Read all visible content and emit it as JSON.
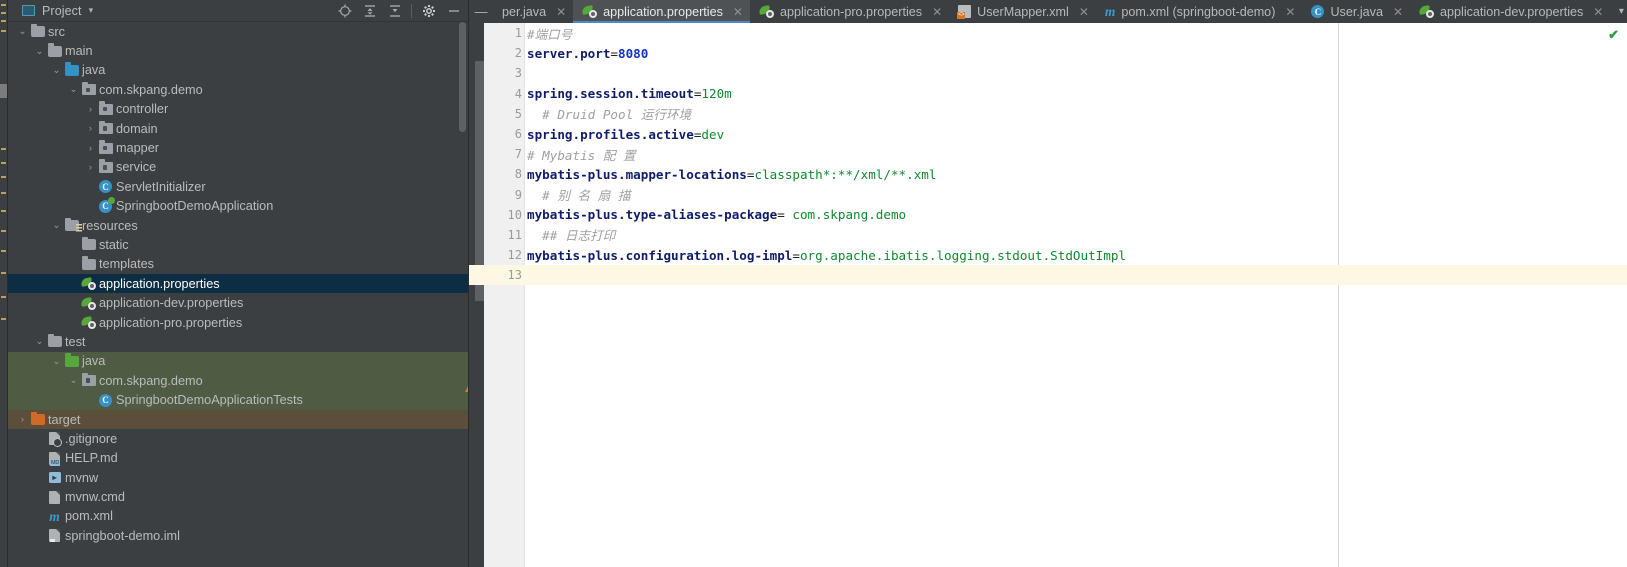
{
  "window": {
    "accent_blue": "#4a88c7",
    "sidebar_bg": "#3c3f41",
    "selection_bg": "#0d2d42"
  },
  "project_panel": {
    "title": "Project",
    "title_chevron": "▾",
    "window_icon": "project-window-icon",
    "tools": [
      {
        "name": "locate-icon",
        "glyph": "⊕"
      },
      {
        "name": "expand-all-icon",
        "glyph": "⇳"
      },
      {
        "name": "collapse-all-icon",
        "glyph": "↧"
      },
      {
        "name": "settings-gear-icon",
        "glyph": "⚙"
      },
      {
        "name": "hide-icon",
        "glyph": "—"
      }
    ],
    "tree": [
      {
        "label": "src",
        "indent": 1,
        "arrow": "v",
        "icon": "folder",
        "state": "normal"
      },
      {
        "label": "main",
        "indent": 2,
        "arrow": "v",
        "icon": "folder",
        "state": "normal"
      },
      {
        "label": "java",
        "indent": 3,
        "arrow": "v",
        "icon": "folder-blue",
        "state": "normal"
      },
      {
        "label": "com.skpang.demo",
        "indent": 4,
        "arrow": "v",
        "icon": "package",
        "state": "normal"
      },
      {
        "label": "controller",
        "indent": 5,
        "arrow": ">",
        "icon": "package",
        "state": "normal"
      },
      {
        "label": "domain",
        "indent": 5,
        "arrow": ">",
        "icon": "package",
        "state": "normal"
      },
      {
        "label": "mapper",
        "indent": 5,
        "arrow": ">",
        "icon": "package",
        "state": "normal"
      },
      {
        "label": "service",
        "indent": 5,
        "arrow": ">",
        "icon": "package",
        "state": "normal"
      },
      {
        "label": "ServletInitializer",
        "indent": 5,
        "arrow": "",
        "icon": "class",
        "state": "normal"
      },
      {
        "label": "SpringbootDemoApplication",
        "indent": 5,
        "arrow": "",
        "icon": "class-runnable",
        "state": "normal"
      },
      {
        "label": "resources",
        "indent": 3,
        "arrow": "v",
        "icon": "folder-res",
        "state": "normal"
      },
      {
        "label": "static",
        "indent": 4,
        "arrow": "",
        "icon": "folder",
        "state": "normal"
      },
      {
        "label": "templates",
        "indent": 4,
        "arrow": "",
        "icon": "folder",
        "state": "normal"
      },
      {
        "label": "application.properties",
        "indent": 4,
        "arrow": "",
        "icon": "spring-leaf",
        "state": "selected"
      },
      {
        "label": "application-dev.properties",
        "indent": 4,
        "arrow": "",
        "icon": "spring-leaf",
        "state": "normal"
      },
      {
        "label": "application-pro.properties",
        "indent": 4,
        "arrow": "",
        "icon": "spring-leaf",
        "state": "normal"
      },
      {
        "label": "test",
        "indent": 2,
        "arrow": "v",
        "icon": "folder",
        "state": "normal"
      },
      {
        "label": "java",
        "indent": 3,
        "arrow": "v",
        "icon": "folder-green",
        "state": "tint-green"
      },
      {
        "label": "com.skpang.demo",
        "indent": 4,
        "arrow": "v",
        "icon": "package",
        "state": "tint-green"
      },
      {
        "label": "SpringbootDemoApplicationTests",
        "indent": 5,
        "arrow": "",
        "icon": "class-test",
        "state": "tint-green"
      },
      {
        "label": "target",
        "indent": 1,
        "arrow": ">",
        "icon": "folder-orange",
        "state": "tint-brown"
      },
      {
        "label": ".gitignore",
        "indent": 2,
        "arrow": "",
        "icon": "file-git",
        "state": "normal"
      },
      {
        "label": "HELP.md",
        "indent": 2,
        "arrow": "",
        "icon": "file-md",
        "state": "normal"
      },
      {
        "label": "mvnw",
        "indent": 2,
        "arrow": "",
        "icon": "file-sh",
        "state": "normal"
      },
      {
        "label": "mvnw.cmd",
        "indent": 2,
        "arrow": "",
        "icon": "file-cmd",
        "state": "normal"
      },
      {
        "label": "pom.xml",
        "indent": 2,
        "arrow": "",
        "icon": "maven-m",
        "state": "normal"
      },
      {
        "label": "springboot-demo.iml",
        "indent": 2,
        "arrow": "",
        "icon": "file-iml",
        "state": "normal"
      }
    ]
  },
  "tab_bar": {
    "collapse_glyph": "—",
    "close_glyph": "✕",
    "overflow_glyph": "▾",
    "tabs": [
      {
        "label": "per.java",
        "icon": "java-class-icon",
        "active": false,
        "truncated": true
      },
      {
        "label": "application.properties",
        "icon": "spring-properties-icon",
        "active": true,
        "truncated": false
      },
      {
        "label": "application-pro.properties",
        "icon": "spring-properties-icon",
        "active": false,
        "truncated": false
      },
      {
        "label": "UserMapper.xml",
        "icon": "xml-file-icon",
        "active": false,
        "truncated": false
      },
      {
        "label": "pom.xml (springboot-demo)",
        "icon": "maven-file-icon",
        "active": false,
        "truncated": false
      },
      {
        "label": "User.java",
        "icon": "java-class-icon",
        "active": false,
        "truncated": false
      },
      {
        "label": "application-dev.properties",
        "icon": "spring-properties-icon",
        "active": false,
        "truncated": false
      }
    ]
  },
  "editor": {
    "inspection_status_icon": "green-check-icon",
    "inspection_status_glyph": "✔",
    "current_line": 13,
    "lines": [
      {
        "no": 1,
        "segments": [
          {
            "t": "#端口号",
            "c": "cm"
          }
        ]
      },
      {
        "no": 2,
        "segments": [
          {
            "t": "server.port",
            "c": "k"
          },
          {
            "t": "=",
            "c": "eq"
          },
          {
            "t": "8080",
            "c": "vnum"
          }
        ]
      },
      {
        "no": 3,
        "segments": []
      },
      {
        "no": 4,
        "segments": [
          {
            "t": "spring.session.timeout",
            "c": "k"
          },
          {
            "t": "=",
            "c": "eq"
          },
          {
            "t": "120m",
            "c": "v"
          }
        ]
      },
      {
        "no": 5,
        "segments": [
          {
            "t": "  # Druid Pool 运行环境",
            "c": "cm"
          }
        ]
      },
      {
        "no": 6,
        "segments": [
          {
            "t": "spring.profiles.active",
            "c": "k"
          },
          {
            "t": "=",
            "c": "eq"
          },
          {
            "t": "dev",
            "c": "v"
          }
        ]
      },
      {
        "no": 7,
        "segments": [
          {
            "t": "# Mybatis 配 置",
            "c": "cm"
          }
        ]
      },
      {
        "no": 8,
        "segments": [
          {
            "t": "mybatis-plus.mapper-locations",
            "c": "k"
          },
          {
            "t": "=",
            "c": "eq"
          },
          {
            "t": "classpath*:**/xml/**.xml",
            "c": "v"
          }
        ]
      },
      {
        "no": 9,
        "segments": [
          {
            "t": "  # 别 名 扇 描",
            "c": "cm"
          }
        ]
      },
      {
        "no": 10,
        "segments": [
          {
            "t": "mybatis-plus.type-aliases-package",
            "c": "k"
          },
          {
            "t": "=",
            "c": "eq"
          },
          {
            "t": " com.skpang.demo",
            "c": "v"
          }
        ]
      },
      {
        "no": 11,
        "segments": [
          {
            "t": "  ## 日志打印",
            "c": "cm"
          }
        ]
      },
      {
        "no": 12,
        "segments": [
          {
            "t": "mybatis-plus.configuration.log-impl",
            "c": "k"
          },
          {
            "t": "=",
            "c": "eq"
          },
          {
            "t": "org.apache.ibatis.logging.stdout.StdOutImpl",
            "c": "v"
          }
        ]
      },
      {
        "no": 13,
        "segments": []
      }
    ]
  }
}
